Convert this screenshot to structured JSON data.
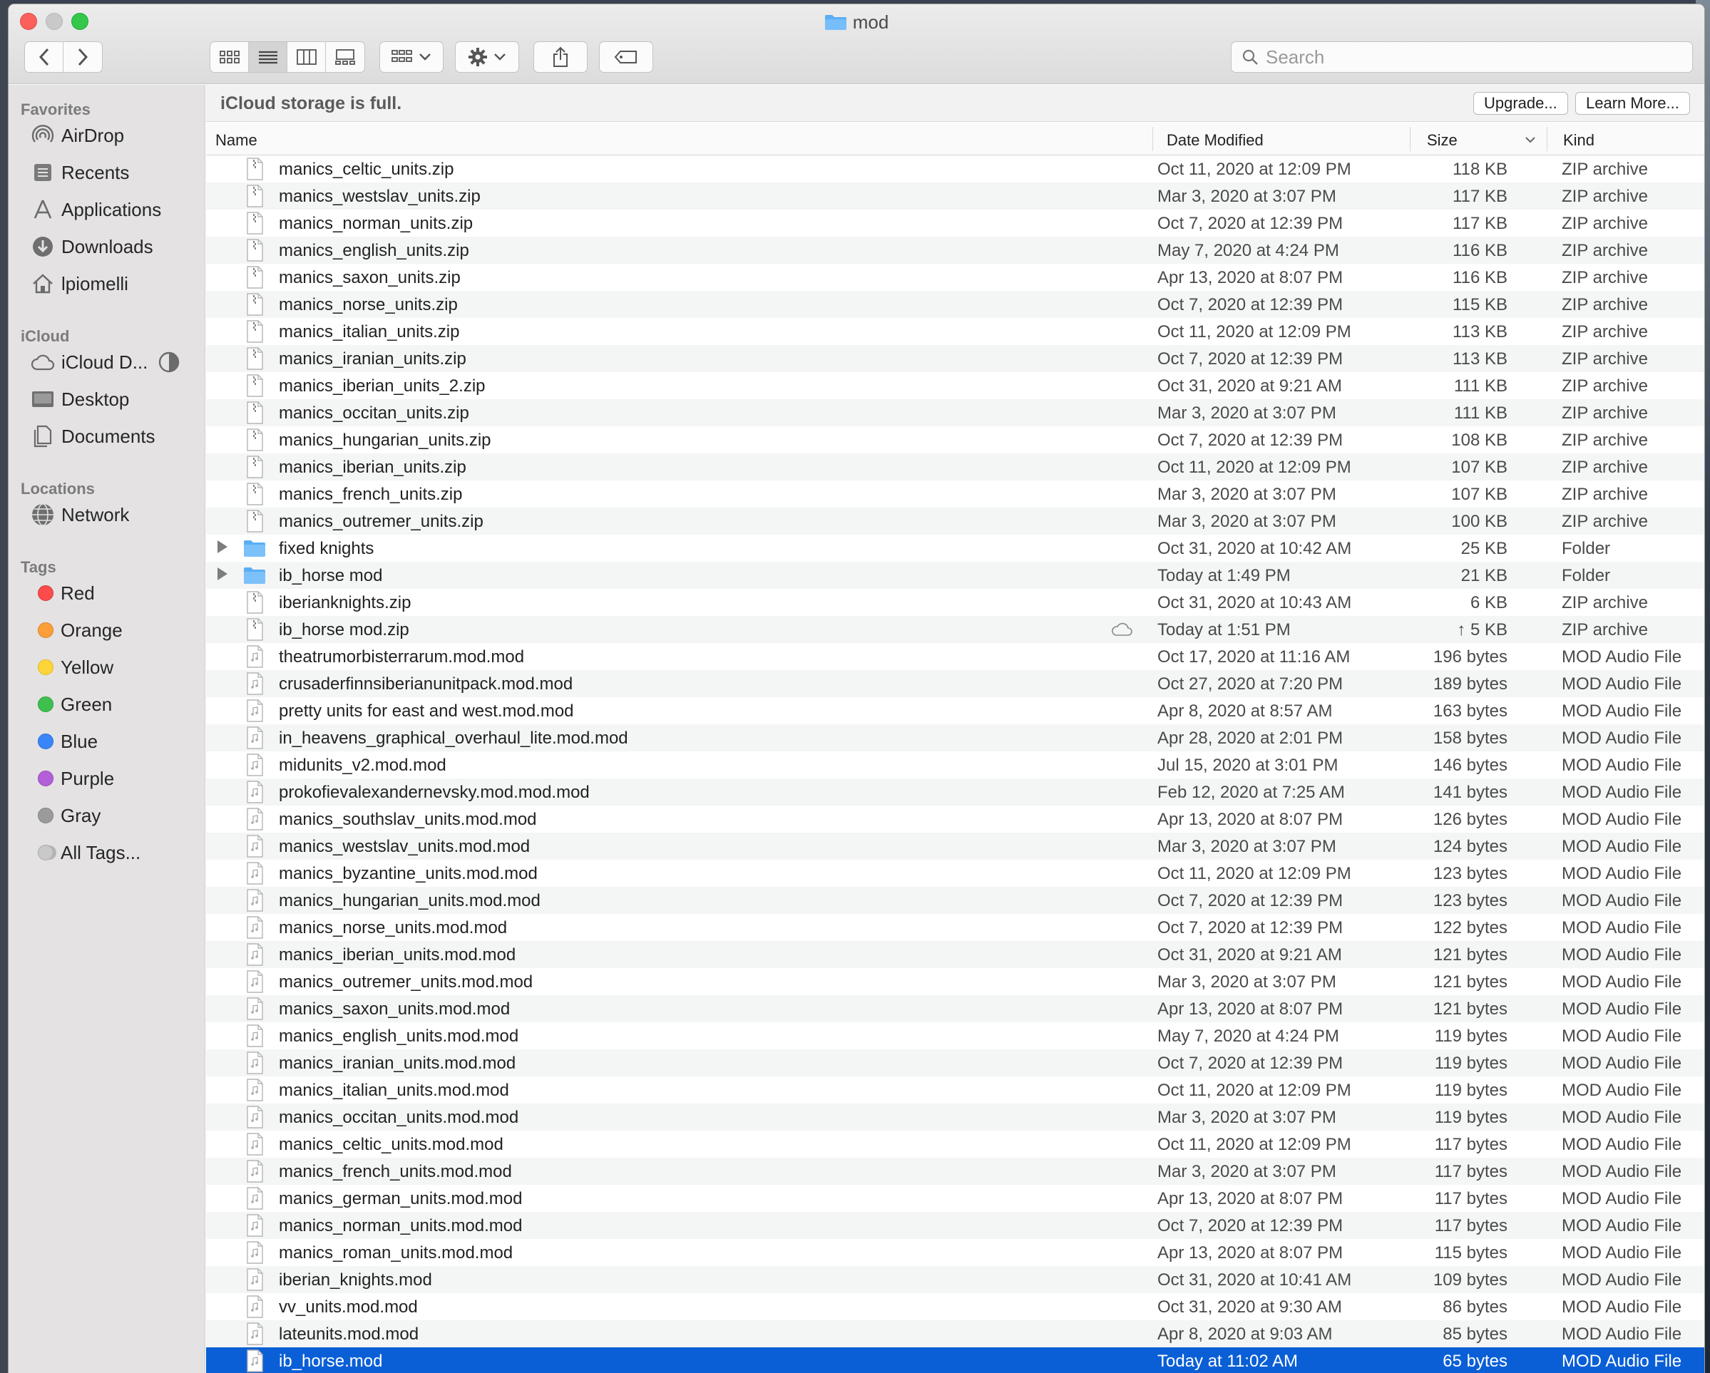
{
  "window": {
    "title": "mod"
  },
  "toolbar": {
    "back_label": "‹",
    "forward_label": "›",
    "search_placeholder": "Search"
  },
  "sidebar": {
    "favorites_header": "Favorites",
    "favorites": [
      {
        "label": "AirDrop",
        "icon": "airdrop-icon"
      },
      {
        "label": "Recents",
        "icon": "recents-icon"
      },
      {
        "label": "Applications",
        "icon": "applications-icon"
      },
      {
        "label": "Downloads",
        "icon": "downloads-icon"
      },
      {
        "label": "lpiomelli",
        "icon": "home-icon"
      }
    ],
    "icloud_header": "iCloud",
    "icloud": [
      {
        "label": "iCloud D...",
        "icon": "icloud-drive-icon"
      },
      {
        "label": "Desktop",
        "icon": "desktop-icon"
      },
      {
        "label": "Documents",
        "icon": "documents-icon"
      }
    ],
    "locations_header": "Locations",
    "locations": [
      {
        "label": "Network",
        "icon": "network-icon"
      }
    ],
    "tags_header": "Tags",
    "tags": [
      {
        "label": "Red",
        "color": "#fb4b4b"
      },
      {
        "label": "Orange",
        "color": "#fc9f3a"
      },
      {
        "label": "Yellow",
        "color": "#fdd43a"
      },
      {
        "label": "Green",
        "color": "#3fc04e"
      },
      {
        "label": "Blue",
        "color": "#3a86f8"
      },
      {
        "label": "Purple",
        "color": "#b35fd8"
      },
      {
        "label": "Gray",
        "color": "#9b9b9b"
      },
      {
        "label": "All Tags...",
        "color": "all"
      }
    ]
  },
  "banner": {
    "text": "iCloud storage is full.",
    "upgrade_label": "Upgrade...",
    "learn_more_label": "Learn More..."
  },
  "columns": {
    "name": "Name",
    "date": "Date Modified",
    "size": "Size",
    "kind": "Kind"
  },
  "files": [
    {
      "name": "manics_celtic_units.zip",
      "date": "Oct 11, 2020 at 12:09 PM",
      "size": "118 KB",
      "kind": "ZIP archive",
      "type": "zip"
    },
    {
      "name": "manics_westslav_units.zip",
      "date": "Mar 3, 2020 at 3:07 PM",
      "size": "117 KB",
      "kind": "ZIP archive",
      "type": "zip"
    },
    {
      "name": "manics_norman_units.zip",
      "date": "Oct 7, 2020 at 12:39 PM",
      "size": "117 KB",
      "kind": "ZIP archive",
      "type": "zip"
    },
    {
      "name": "manics_english_units.zip",
      "date": "May 7, 2020 at 4:24 PM",
      "size": "116 KB",
      "kind": "ZIP archive",
      "type": "zip"
    },
    {
      "name": "manics_saxon_units.zip",
      "date": "Apr 13, 2020 at 8:07 PM",
      "size": "116 KB",
      "kind": "ZIP archive",
      "type": "zip"
    },
    {
      "name": "manics_norse_units.zip",
      "date": "Oct 7, 2020 at 12:39 PM",
      "size": "115 KB",
      "kind": "ZIP archive",
      "type": "zip"
    },
    {
      "name": "manics_italian_units.zip",
      "date": "Oct 11, 2020 at 12:09 PM",
      "size": "113 KB",
      "kind": "ZIP archive",
      "type": "zip"
    },
    {
      "name": "manics_iranian_units.zip",
      "date": "Oct 7, 2020 at 12:39 PM",
      "size": "113 KB",
      "kind": "ZIP archive",
      "type": "zip"
    },
    {
      "name": "manics_iberian_units_2.zip",
      "date": "Oct 31, 2020 at 9:21 AM",
      "size": "111 KB",
      "kind": "ZIP archive",
      "type": "zip"
    },
    {
      "name": "manics_occitan_units.zip",
      "date": "Mar 3, 2020 at 3:07 PM",
      "size": "111 KB",
      "kind": "ZIP archive",
      "type": "zip"
    },
    {
      "name": "manics_hungarian_units.zip",
      "date": "Oct 7, 2020 at 12:39 PM",
      "size": "108 KB",
      "kind": "ZIP archive",
      "type": "zip"
    },
    {
      "name": "manics_iberian_units.zip",
      "date": "Oct 11, 2020 at 12:09 PM",
      "size": "107 KB",
      "kind": "ZIP archive",
      "type": "zip"
    },
    {
      "name": "manics_french_units.zip",
      "date": "Mar 3, 2020 at 3:07 PM",
      "size": "107 KB",
      "kind": "ZIP archive",
      "type": "zip"
    },
    {
      "name": "manics_outremer_units.zip",
      "date": "Mar 3, 2020 at 3:07 PM",
      "size": "100 KB",
      "kind": "ZIP archive",
      "type": "zip"
    },
    {
      "name": "fixed knights",
      "date": "Oct 31, 2020 at 10:42 AM",
      "size": "25 KB",
      "kind": "Folder",
      "type": "folder"
    },
    {
      "name": "ib_horse mod",
      "date": "Today at 1:49 PM",
      "size": "21 KB",
      "kind": "Folder",
      "type": "folder"
    },
    {
      "name": "iberianknights.zip",
      "date": "Oct 31, 2020 at 10:43 AM",
      "size": "6 KB",
      "kind": "ZIP archive",
      "type": "zip"
    },
    {
      "name": "ib_horse mod.zip",
      "date": "Today at 1:51 PM",
      "size": "↑ 5 KB",
      "kind": "ZIP archive",
      "type": "zip",
      "cloud": true
    },
    {
      "name": "theatrumorbisterrarum.mod.mod",
      "date": "Oct 17, 2020 at 11:16 AM",
      "size": "196 bytes",
      "kind": "MOD Audio File",
      "type": "mod"
    },
    {
      "name": "crusaderfinnsiberianunitpack.mod.mod",
      "date": "Oct 27, 2020 at 7:20 PM",
      "size": "189 bytes",
      "kind": "MOD Audio File",
      "type": "mod"
    },
    {
      "name": "pretty units for east and west.mod.mod",
      "date": "Apr 8, 2020 at 8:57 AM",
      "size": "163 bytes",
      "kind": "MOD Audio File",
      "type": "mod"
    },
    {
      "name": "in_heavens_graphical_overhaul_lite.mod.mod",
      "date": "Apr 28, 2020 at 2:01 PM",
      "size": "158 bytes",
      "kind": "MOD Audio File",
      "type": "mod"
    },
    {
      "name": "midunits_v2.mod.mod",
      "date": "Jul 15, 2020 at 3:01 PM",
      "size": "146 bytes",
      "kind": "MOD Audio File",
      "type": "mod"
    },
    {
      "name": "prokofievalexandernevsky.mod.mod.mod",
      "date": "Feb 12, 2020 at 7:25 AM",
      "size": "141 bytes",
      "kind": "MOD Audio File",
      "type": "mod"
    },
    {
      "name": "manics_southslav_units.mod.mod",
      "date": "Apr 13, 2020 at 8:07 PM",
      "size": "126 bytes",
      "kind": "MOD Audio File",
      "type": "mod"
    },
    {
      "name": "manics_westslav_units.mod.mod",
      "date": "Mar 3, 2020 at 3:07 PM",
      "size": "124 bytes",
      "kind": "MOD Audio File",
      "type": "mod"
    },
    {
      "name": "manics_byzantine_units.mod.mod",
      "date": "Oct 11, 2020 at 12:09 PM",
      "size": "123 bytes",
      "kind": "MOD Audio File",
      "type": "mod"
    },
    {
      "name": "manics_hungarian_units.mod.mod",
      "date": "Oct 7, 2020 at 12:39 PM",
      "size": "123 bytes",
      "kind": "MOD Audio File",
      "type": "mod"
    },
    {
      "name": "manics_norse_units.mod.mod",
      "date": "Oct 7, 2020 at 12:39 PM",
      "size": "122 bytes",
      "kind": "MOD Audio File",
      "type": "mod"
    },
    {
      "name": "manics_iberian_units.mod.mod",
      "date": "Oct 31, 2020 at 9:21 AM",
      "size": "121 bytes",
      "kind": "MOD Audio File",
      "type": "mod"
    },
    {
      "name": "manics_outremer_units.mod.mod",
      "date": "Mar 3, 2020 at 3:07 PM",
      "size": "121 bytes",
      "kind": "MOD Audio File",
      "type": "mod"
    },
    {
      "name": "manics_saxon_units.mod.mod",
      "date": "Apr 13, 2020 at 8:07 PM",
      "size": "121 bytes",
      "kind": "MOD Audio File",
      "type": "mod"
    },
    {
      "name": "manics_english_units.mod.mod",
      "date": "May 7, 2020 at 4:24 PM",
      "size": "119 bytes",
      "kind": "MOD Audio File",
      "type": "mod"
    },
    {
      "name": "manics_iranian_units.mod.mod",
      "date": "Oct 7, 2020 at 12:39 PM",
      "size": "119 bytes",
      "kind": "MOD Audio File",
      "type": "mod"
    },
    {
      "name": "manics_italian_units.mod.mod",
      "date": "Oct 11, 2020 at 12:09 PM",
      "size": "119 bytes",
      "kind": "MOD Audio File",
      "type": "mod"
    },
    {
      "name": "manics_occitan_units.mod.mod",
      "date": "Mar 3, 2020 at 3:07 PM",
      "size": "119 bytes",
      "kind": "MOD Audio File",
      "type": "mod"
    },
    {
      "name": "manics_celtic_units.mod.mod",
      "date": "Oct 11, 2020 at 12:09 PM",
      "size": "117 bytes",
      "kind": "MOD Audio File",
      "type": "mod"
    },
    {
      "name": "manics_french_units.mod.mod",
      "date": "Mar 3, 2020 at 3:07 PM",
      "size": "117 bytes",
      "kind": "MOD Audio File",
      "type": "mod"
    },
    {
      "name": "manics_german_units.mod.mod",
      "date": "Apr 13, 2020 at 8:07 PM",
      "size": "117 bytes",
      "kind": "MOD Audio File",
      "type": "mod"
    },
    {
      "name": "manics_norman_units.mod.mod",
      "date": "Oct 7, 2020 at 12:39 PM",
      "size": "117 bytes",
      "kind": "MOD Audio File",
      "type": "mod"
    },
    {
      "name": "manics_roman_units.mod.mod",
      "date": "Apr 13, 2020 at 8:07 PM",
      "size": "115 bytes",
      "kind": "MOD Audio File",
      "type": "mod"
    },
    {
      "name": "iberian_knights.mod",
      "date": "Oct 31, 2020 at 10:41 AM",
      "size": "109 bytes",
      "kind": "MOD Audio File",
      "type": "mod"
    },
    {
      "name": "vv_units.mod.mod",
      "date": "Oct 31, 2020 at 9:30 AM",
      "size": "86 bytes",
      "kind": "MOD Audio File",
      "type": "mod"
    },
    {
      "name": "lateunits.mod.mod",
      "date": "Apr 8, 2020 at 9:03 AM",
      "size": "85 bytes",
      "kind": "MOD Audio File",
      "type": "mod"
    },
    {
      "name": "ib_horse.mod",
      "date": "Today at 11:02 AM",
      "size": "65 bytes",
      "kind": "MOD Audio File",
      "type": "mod",
      "selected": true
    }
  ]
}
